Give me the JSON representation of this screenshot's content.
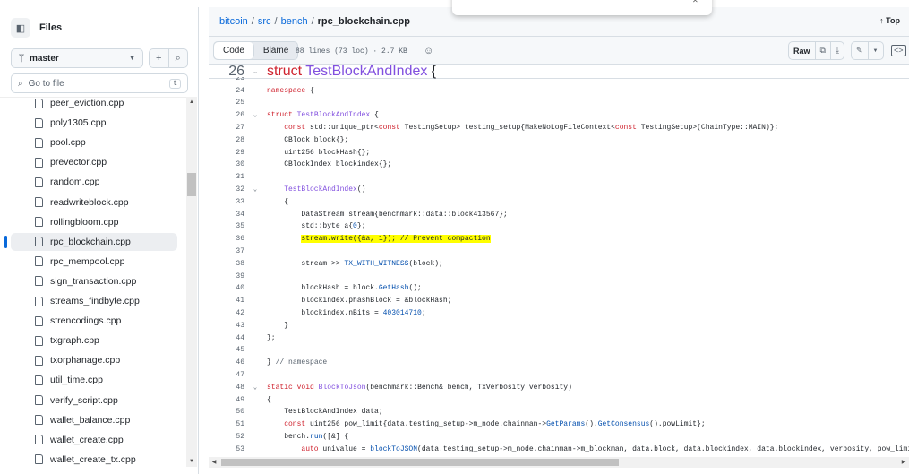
{
  "sidebar": {
    "title": "Files",
    "branch": "master",
    "goto_placeholder": "Go to file",
    "goto_shortcut": "t",
    "files": [
      "peer_eviction.cpp",
      "poly1305.cpp",
      "pool.cpp",
      "prevector.cpp",
      "random.cpp",
      "readwriteblock.cpp",
      "rollingbloom.cpp",
      "rpc_blockchain.cpp",
      "rpc_mempool.cpp",
      "sign_transaction.cpp",
      "streams_findbyte.cpp",
      "strencodings.cpp",
      "txgraph.cpp",
      "txorphanage.cpp",
      "util_time.cpp",
      "verify_script.cpp",
      "wallet_balance.cpp",
      "wallet_create.cpp",
      "wallet_create_tx.cpp"
    ],
    "active_file": "rpc_blockchain.cpp"
  },
  "breadcrumb": {
    "repo": "bitcoin",
    "dir1": "src",
    "dir2": "bench",
    "file": "rpc_blockchain.cpp",
    "sep": "/"
  },
  "top_link": "↑ Top",
  "toolbar": {
    "code_tab": "Code",
    "blame_tab": "Blame",
    "file_meta": "88 lines (73 loc) · 2.7 KB",
    "raw": "Raw"
  },
  "sticky": {
    "num": "26",
    "tokens": [
      [
        "struct ",
        "k"
      ],
      [
        "TestBlockAndIndex",
        "f"
      ],
      [
        " {",
        "p"
      ]
    ]
  },
  "lines": [
    {
      "n": "24",
      "t": [
        [
          "namespace",
          "k"
        ],
        [
          " {",
          "p"
        ]
      ]
    },
    {
      "n": "25",
      "t": []
    },
    {
      "n": "26",
      "fold": true,
      "t": [
        [
          "struct ",
          "k"
        ],
        [
          "TestBlockAndIndex",
          "f"
        ],
        [
          " {",
          "p"
        ]
      ]
    },
    {
      "n": "27",
      "t": [
        [
          "    ",
          "p"
        ],
        [
          "const",
          "k"
        ],
        [
          " std::unique_ptr<",
          "p"
        ],
        [
          "const",
          "k"
        ],
        [
          " TestingSetup> testing_setup{MakeNoLogFileContext<",
          "p"
        ],
        [
          "const",
          "k"
        ],
        [
          " TestingSetup>(ChainType::MAIN)};",
          "p"
        ]
      ]
    },
    {
      "n": "28",
      "t": [
        [
          "    CBlock block{};",
          "p"
        ]
      ]
    },
    {
      "n": "29",
      "t": [
        [
          "    uint256 blockHash{};",
          "p"
        ]
      ]
    },
    {
      "n": "30",
      "t": [
        [
          "    CBlockIndex blockindex{};",
          "p"
        ]
      ]
    },
    {
      "n": "31",
      "t": []
    },
    {
      "n": "32",
      "fold": true,
      "t": [
        [
          "    ",
          "p"
        ],
        [
          "TestBlockAndIndex",
          "f"
        ],
        [
          "()",
          "p"
        ]
      ]
    },
    {
      "n": "33",
      "t": [
        [
          "    {",
          "p"
        ]
      ]
    },
    {
      "n": "34",
      "t": [
        [
          "        DataStream stream{benchmark::data::block413567};",
          "p"
        ]
      ]
    },
    {
      "n": "35",
      "t": [
        [
          "        std::byte a{",
          "p"
        ],
        [
          "0",
          "c"
        ],
        [
          "};",
          "p"
        ]
      ]
    },
    {
      "n": "36",
      "t": [
        [
          "        ",
          "p"
        ],
        [
          "stream.write({&a, 1}); // Prevent compaction",
          "hl"
        ]
      ]
    },
    {
      "n": "37",
      "t": []
    },
    {
      "n": "38",
      "t": [
        [
          "        stream >> ",
          "p"
        ],
        [
          "TX_WITH_WITNESS",
          "c"
        ],
        [
          "(block);",
          "p"
        ]
      ]
    },
    {
      "n": "39",
      "t": []
    },
    {
      "n": "40",
      "t": [
        [
          "        blockHash = block.",
          "p"
        ],
        [
          "GetHash",
          "c"
        ],
        [
          "();",
          "p"
        ]
      ]
    },
    {
      "n": "41",
      "t": [
        [
          "        blockindex.phashBlock = &blockHash;",
          "p"
        ]
      ]
    },
    {
      "n": "42",
      "t": [
        [
          "        blockindex.nBits = ",
          "p"
        ],
        [
          "403014710",
          "c"
        ],
        [
          ";",
          "p"
        ]
      ]
    },
    {
      "n": "43",
      "t": [
        [
          "    }",
          "p"
        ]
      ]
    },
    {
      "n": "44",
      "t": [
        [
          "};",
          "p"
        ]
      ]
    },
    {
      "n": "45",
      "t": []
    },
    {
      "n": "46",
      "t": [
        [
          "} ",
          "p"
        ],
        [
          "// namespace",
          "m"
        ]
      ]
    },
    {
      "n": "47",
      "t": []
    },
    {
      "n": "48",
      "fold": true,
      "t": [
        [
          "static",
          "k"
        ],
        [
          " ",
          "p"
        ],
        [
          "void",
          "k"
        ],
        [
          " ",
          "p"
        ],
        [
          "BlockToJson",
          "f"
        ],
        [
          "(benchmark::Bench& bench, TxVerbosity verbosity)",
          "p"
        ]
      ]
    },
    {
      "n": "49",
      "t": [
        [
          "{",
          "p"
        ]
      ]
    },
    {
      "n": "50",
      "t": [
        [
          "    TestBlockAndIndex data;",
          "p"
        ]
      ]
    },
    {
      "n": "51",
      "t": [
        [
          "    ",
          "p"
        ],
        [
          "const",
          "k"
        ],
        [
          " uint256 pow_limit{data.testing_setup->m_node.chainman->",
          "p"
        ],
        [
          "GetParams",
          "c"
        ],
        [
          "().",
          "p"
        ],
        [
          "GetConsensus",
          "c"
        ],
        [
          "().powLimit};",
          "p"
        ]
      ]
    },
    {
      "n": "52",
      "t": [
        [
          "    bench.",
          "p"
        ],
        [
          "run",
          "c"
        ],
        [
          "([&] {",
          "p"
        ]
      ]
    },
    {
      "n": "53",
      "t": [
        [
          "        ",
          "p"
        ],
        [
          "auto",
          "k"
        ],
        [
          " univalue = ",
          "p"
        ],
        [
          "blockToJSON",
          "c"
        ],
        [
          "(data.testing_setup->m_node.chainman->m_blockman, data.block, data.blockindex, data.blockindex, verbosity, pow_limit);",
          "p"
        ]
      ]
    }
  ]
}
